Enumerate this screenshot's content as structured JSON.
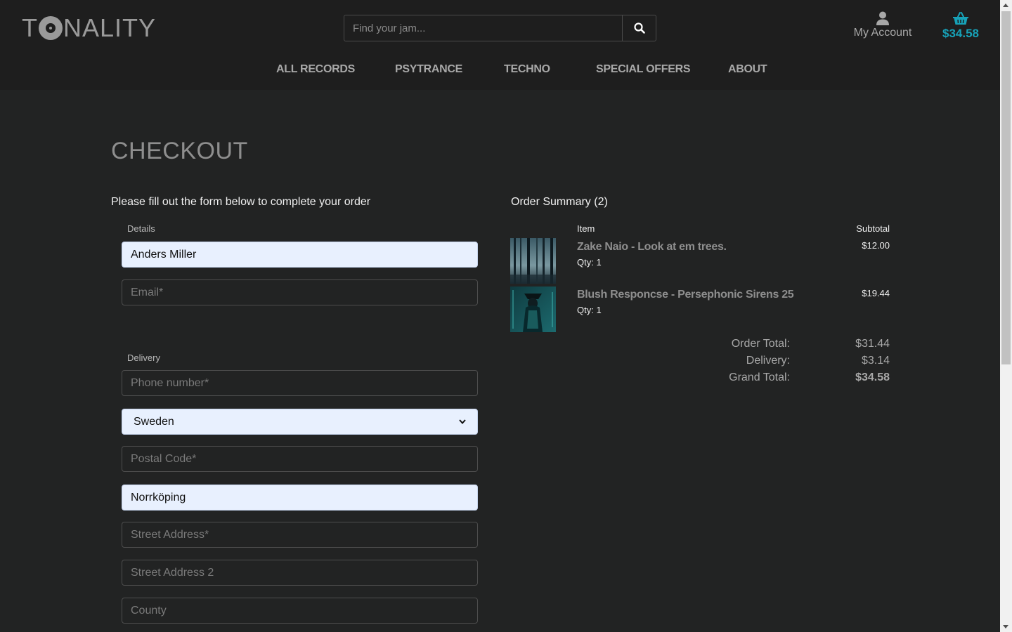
{
  "header": {
    "logo_prefix": "T",
    "logo_suffix": "NALITY",
    "search_placeholder": "Find your jam...",
    "account_label": "My Account",
    "cart_total": "$34.58",
    "accent_color": "#17a2b8"
  },
  "nav": [
    "ALL RECORDS",
    "PSYTRANCE",
    "TECHNO",
    "SPECIAL OFFERS",
    "ABOUT"
  ],
  "checkout": {
    "title": "CHECKOUT",
    "intro": "Please fill out the form below to complete your order",
    "details_label": "Details",
    "full_name_value": "Anders Miller",
    "email_placeholder": "Email*",
    "delivery_label": "Delivery",
    "phone_placeholder": "Phone number*",
    "country_value": "Sweden",
    "postal_placeholder": "Postal Code*",
    "town_value": "Norrköping",
    "street1_placeholder": "Street Address*",
    "street2_placeholder": "Street Address 2",
    "county_placeholder": "County"
  },
  "summary": {
    "title": "Order Summary (2)",
    "col_item": "Item",
    "col_subtotal": "Subtotal",
    "items": [
      {
        "name": "Zake Naio - Look at em trees.",
        "qty": "Qty: 1",
        "price": "$12.00"
      },
      {
        "name": "Blush Responcse - Persephonic Sirens 25",
        "qty": "Qty: 1",
        "price": "$19.44"
      }
    ],
    "order_total_label": "Order Total:",
    "order_total": "$31.44",
    "delivery_label": "Delivery:",
    "delivery": "$3.14",
    "grand_total_label": "Grand Total:",
    "grand_total": "$34.58"
  }
}
